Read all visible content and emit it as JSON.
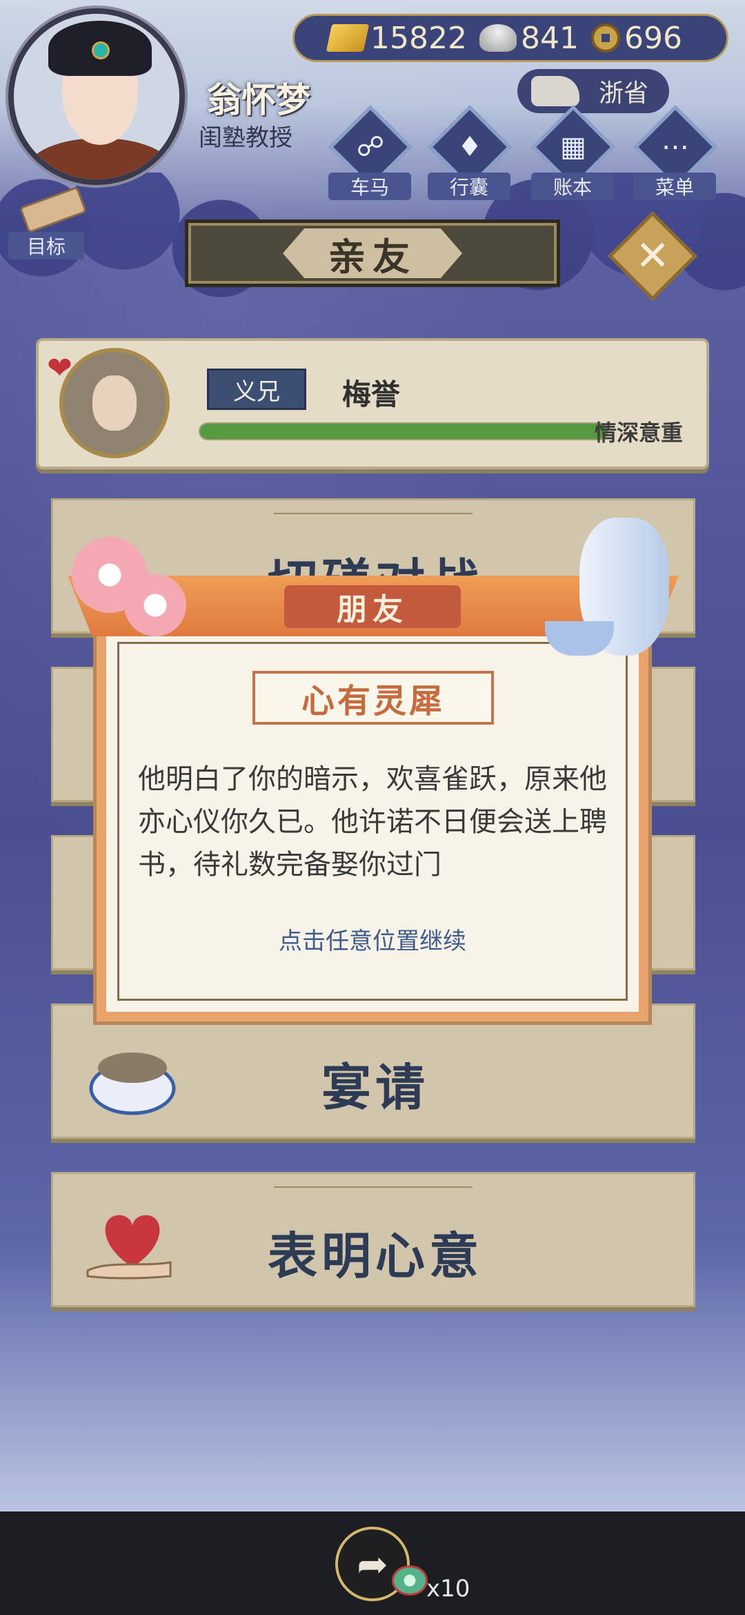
{
  "hud": {
    "currencies": [
      {
        "icon": "gold-ingot-icon",
        "value": "15822"
      },
      {
        "icon": "silver-ingot-icon",
        "value": "841"
      },
      {
        "icon": "copper-coin-icon",
        "value": "696"
      }
    ],
    "player": {
      "name": "翁怀梦",
      "title": "闺塾教授"
    },
    "region": "浙省",
    "buttons": [
      {
        "label": "车马",
        "icon": "carriage-icon"
      },
      {
        "label": "行囊",
        "icon": "bag-icon"
      },
      {
        "label": "账本",
        "icon": "ledger-icon"
      },
      {
        "label": "菜单",
        "icon": "menu-dots-icon"
      }
    ],
    "goal_label": "目标"
  },
  "header": {
    "title": "亲友"
  },
  "friend": {
    "relation": "义兄",
    "name": "梅誉",
    "bond_text": "情深意重",
    "bond_level": 1.0
  },
  "actions": [
    {
      "label": "切磋对战",
      "icon": "duel-icon"
    },
    {
      "label": "",
      "icon": "gift-icon"
    },
    {
      "label": "",
      "icon": "chat-icon"
    },
    {
      "label": "宴请",
      "icon": "banquet-dish-icon"
    },
    {
      "label": "表明心意",
      "icon": "heart-hand-icon"
    }
  ],
  "popup": {
    "title": "朋友",
    "subtitle": "心有灵犀",
    "body": "他明白了你的暗示，欢喜雀跃，原来他亦心仪你久已。他许诺不日便会送上聘书，待礼数完备娶你过门",
    "hint": "点击任意位置继续"
  },
  "bottom": {
    "share_count": "x10"
  },
  "colors": {
    "accent_orange": "#e7a36a",
    "bond_green": "#559a3e",
    "hint_blue": "#3e5c8a",
    "title_red": "#c35a3c"
  }
}
